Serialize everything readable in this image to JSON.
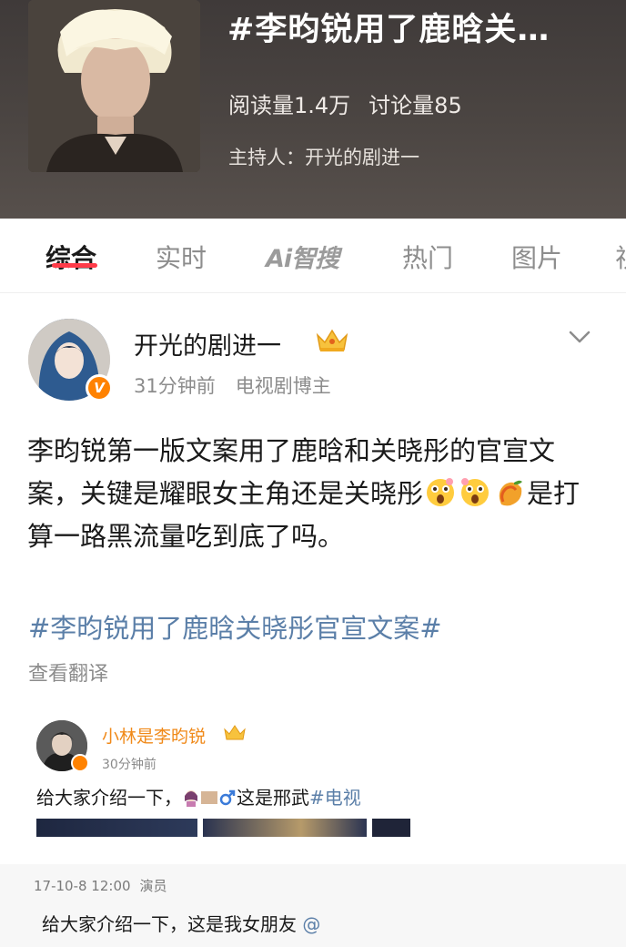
{
  "topic": {
    "title": "#李昀锐用了鹿晗关…",
    "read_count": "阅读量1.4万",
    "discussion_count": "讨论量85",
    "host": "主持人：开光的剧进一"
  },
  "tabs": [
    {
      "label": "综合",
      "active": true
    },
    {
      "label": "实时",
      "active": false
    },
    {
      "label": "Ai智搜",
      "active": false
    },
    {
      "label": "热门",
      "active": false
    },
    {
      "label": "图片",
      "active": false
    }
  ],
  "post": {
    "author": "开光的剧进一",
    "time": "31分钟前",
    "role": "电视剧博主",
    "text_part1": "李昀锐第一版文案用了鹿晗和关晓彤的官宣文案，关键是耀眼女主角还是关晓彤",
    "text_part2": "是打算一路黑流量吃到底了吗。",
    "hashtag": "#李昀锐用了鹿晗关晓彤官宣文案#",
    "translate": "查看翻译"
  },
  "embedded": {
    "author": "小林是李昀锐",
    "time": "30分钟前",
    "text": "给大家介绍一下，",
    "text_cont": "这是邢武",
    "tag": "#电视",
    "repost_time": "17-10-8 12:00",
    "repost_role": "演员",
    "repost_text": "给大家介绍一下，这是我女朋友",
    "repost_at": "@"
  },
  "icons": {
    "crown": "crown-icon",
    "chevron": "chevron-down-icon",
    "verified": "verified-badge-icon",
    "astonished": "astonished-face-emoji",
    "mango": "mango-emoji"
  },
  "colors": {
    "accent": "#ff3b49",
    "link": "#5b7fa8",
    "verified": "#ff8200",
    "muted": "#8c8c8c"
  }
}
